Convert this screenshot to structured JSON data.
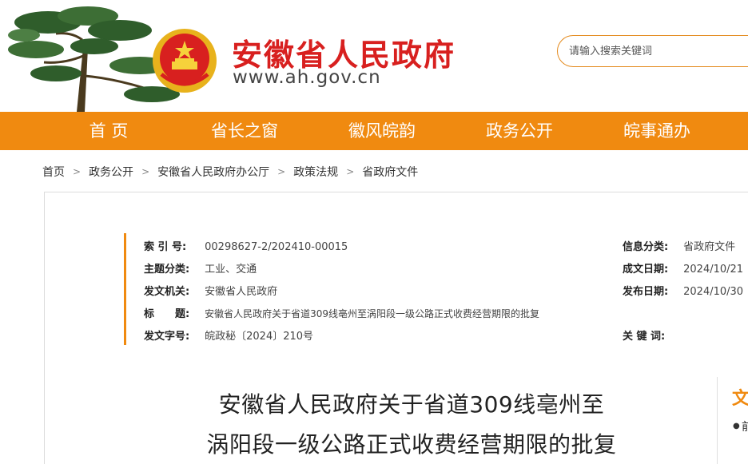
{
  "header": {
    "site_title": "安徽省人民政府",
    "site_url": "www.ah.gov.cn",
    "search_placeholder": "请输入搜索关键词"
  },
  "nav": {
    "items": [
      {
        "label": "首 页"
      },
      {
        "label": "省长之窗"
      },
      {
        "label": "徽风皖韵"
      },
      {
        "label": "政务公开"
      },
      {
        "label": "皖事通办"
      }
    ]
  },
  "breadcrumb": {
    "items": [
      "首页",
      "政务公开",
      "安徽省人民政府办公厅",
      "政策法规",
      "省政府文件"
    ],
    "separator": ">"
  },
  "meta": {
    "index_label": "索 引 号:",
    "index_value": "00298627-2/202410-00015",
    "topic_label": "主题分类:",
    "topic_value": "工业、交通",
    "issuer_label": "发文机关:",
    "issuer_value": "安徽省人民政府",
    "title_label": "标　　题:",
    "title_value": "安徽省人民政府关于省道309线亳州至涡阳段一级公路正式收费经营期限的批复",
    "docno_label": "发文字号:",
    "docno_value": "皖政秘〔2024〕210号",
    "category_label": "信息分类:",
    "category_value": "省政府文件",
    "created_label": "成文日期:",
    "created_value": "2024/10/21",
    "published_label": "发布日期:",
    "published_value": "2024/10/30",
    "keywords_label": "关 键 词:",
    "keywords_value": ""
  },
  "document": {
    "title_line1": "安徽省人民政府关于省道309线亳州至",
    "title_line2": "涡阳段一级公路正式收费经营期限的批复"
  },
  "side_panel": {
    "heading": "文",
    "item_text": "前"
  },
  "colors": {
    "brand_red": "#d8201f",
    "nav_orange": "#f08a10"
  }
}
